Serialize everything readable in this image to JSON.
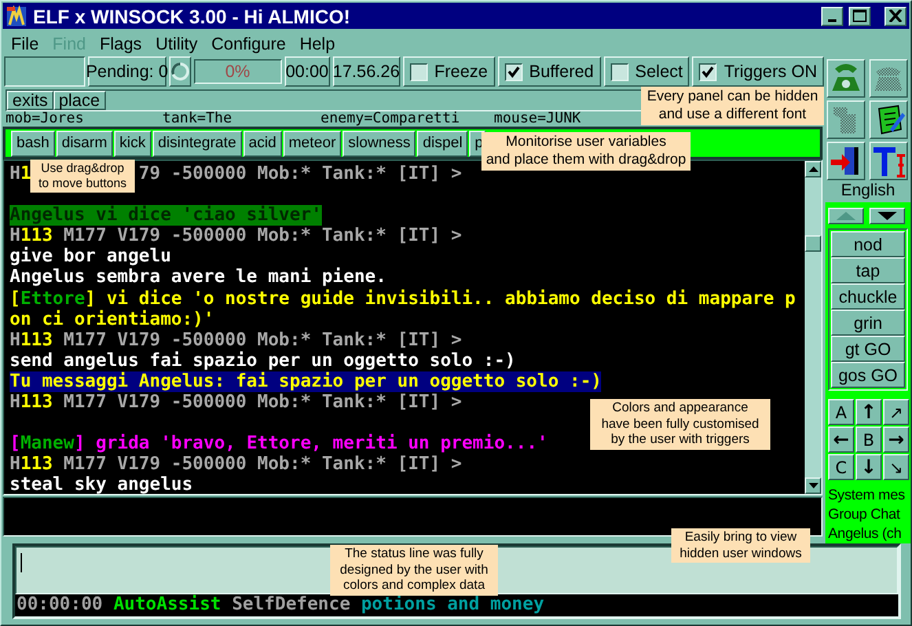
{
  "window": {
    "title": "ELF x WINSOCK 3.00 - Hi ALMICO!"
  },
  "menu": [
    {
      "label": "File",
      "disabled": false
    },
    {
      "label": "Find",
      "disabled": true
    },
    {
      "label": "Flags",
      "disabled": false
    },
    {
      "label": "Utility",
      "disabled": false
    },
    {
      "label": "Configure",
      "disabled": false
    },
    {
      "label": "Help",
      "disabled": false
    }
  ],
  "toolbar": {
    "pending": "Pending: 0",
    "progress": {
      "label": "0%",
      "level": 0
    },
    "timer": "00:00",
    "clock": "17.56.26",
    "checkboxes": [
      {
        "label": "Freeze",
        "checked": false
      },
      {
        "label": "Buffered",
        "checked": true
      },
      {
        "label": "Select",
        "checked": false
      },
      {
        "label": "Triggers ON",
        "checked": true
      }
    ]
  },
  "panel_buttons": [
    "exits",
    "place"
  ],
  "variables": [
    "mob=Jores",
    "tank=The",
    "enemy=Comparetti",
    "mouse=JUNK"
  ],
  "action_buttons": [
    "bash",
    "disarm",
    "kick",
    "disintegrate",
    "acid",
    "meteor",
    "slowness",
    "dispel",
    "p"
  ],
  "terminal": {
    "lines": [
      {
        "segments": [
          {
            "text": "H",
            "color": "#a8a8a8"
          },
          {
            "text": "1",
            "color": "#ffff00"
          },
          {
            "text": "79 -500000 Mob:* Tank:* [IT] >",
            "color": "#a8a8a8",
            "kind": "after-note"
          }
        ]
      },
      {
        "kind": "blank"
      },
      {
        "color": "#008000",
        "segments": [
          {
            "text": "Angelus vi dice 'ciao silver'"
          }
        ]
      },
      {
        "segments": [
          {
            "text": "H",
            "color": "#a8a8a8"
          },
          {
            "text": "113",
            "color": "#ffff00"
          },
          {
            "text": " M177 V179 -500000 Mob:* Tank:* [IT] >",
            "color": "#a8a8a8"
          }
        ]
      },
      {
        "segments": [
          {
            "text": "give bor angelu",
            "color": "#ffffff"
          }
        ]
      },
      {
        "segments": [
          {
            "text": "Angelus sembra avere le mani piene.",
            "color": "#ffffff"
          }
        ]
      },
      {
        "segments": [
          {
            "text": "[",
            "color": "#ffff00"
          },
          {
            "text": "Ettore",
            "color": "#00b000"
          },
          {
            "text": "] vi dice 'o nostre guide invisibili.. abbiamo deciso di mappare p",
            "color": "#ffff00"
          }
        ]
      },
      {
        "segments": [
          {
            "text": "on ci orientiamo:)'",
            "color": "#ffff00"
          }
        ]
      },
      {
        "segments": [
          {
            "text": "H",
            "color": "#a8a8a8"
          },
          {
            "text": "113",
            "color": "#ffff00"
          },
          {
            "text": " M177 V179 -500000 Mob:* Tank:* [IT] >",
            "color": "#a8a8a8"
          }
        ]
      },
      {
        "segments": [
          {
            "text": "send angelus fai spazio per un oggetto solo :-)",
            "color": "#ffffff"
          }
        ]
      },
      {
        "color": "#000080",
        "segments": [
          {
            "text": "Tu messaggi Angelus: fai spazio per un oggetto solo :-)"
          }
        ]
      },
      {
        "segments": [
          {
            "text": "H",
            "color": "#a8a8a8"
          },
          {
            "text": "113",
            "color": "#ffff00"
          },
          {
            "text": " M177 V179 -500000 Mob:* Tank:* [IT] >",
            "color": "#a8a8a8"
          }
        ]
      },
      {
        "kind": "blank"
      },
      {
        "segments": [
          {
            "text": "[",
            "color": "#ff00ff"
          },
          {
            "text": "Manew",
            "color": "#00b000"
          },
          {
            "text": "] grida 'bravo, Ettore, meriti un premio...'",
            "color": "#ff00ff"
          }
        ]
      },
      {
        "segments": [
          {
            "text": "H",
            "color": "#a8a8a8"
          },
          {
            "text": "113",
            "color": "#ffff00"
          },
          {
            "text": " M177 V179 -500000 Mob:* Tank:* [IT] >",
            "color": "#a8a8a8"
          }
        ]
      },
      {
        "segments": [
          {
            "text": "steal sky angelus",
            "color": "#ffffff"
          }
        ]
      }
    ]
  },
  "sidebar": {
    "tool_buttons": [
      {
        "disabled": false
      },
      {
        "disabled": true
      },
      {
        "disabled": true
      },
      {
        "disabled": false
      },
      {
        "disabled": false
      },
      {
        "disabled": false
      }
    ],
    "language": "English",
    "scroll_buttons": [
      {
        "kind": "up",
        "disabled": true
      },
      {
        "kind": "down",
        "disabled": false
      }
    ],
    "macro_buttons": [
      "nod",
      "tap",
      "chuckle",
      "grin",
      "gt GO",
      "gos GO"
    ],
    "direction_pad": [
      "A",
      "↑",
      "↗",
      "←",
      "B",
      "→",
      "C",
      "↓",
      "↘"
    ],
    "windows": [
      "System mes",
      "Group Chat",
      "Angelus (ch"
    ]
  },
  "status_line": [
    {
      "text": "00:00:00",
      "color": "#a0a0a0"
    },
    {
      "text": "AutoAssist",
      "color": "#00e000"
    },
    {
      "text": "SelfDefence",
      "color": "#a0a0a0"
    },
    {
      "text": "potions and money",
      "color": "#00a0a0"
    }
  ],
  "notes": [
    "Use drag&drop\nto move buttons",
    "Every panel can be hidden\nand use a different font",
    "Monitorise user variables\nand place them with drag&drop",
    "Colors and appearance\nhave been fully customised\nby the user with triggers",
    "The status line was fully\ndesigned by the user with\ncolors and complex data",
    "Easily bring to view\nhidden user windows"
  ]
}
